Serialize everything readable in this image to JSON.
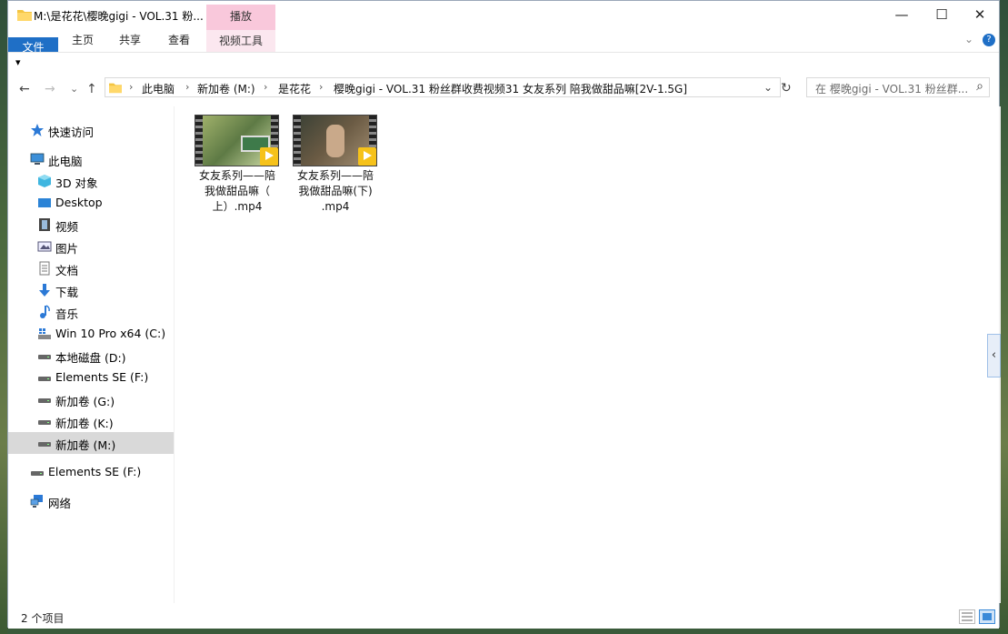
{
  "window": {
    "title": "M:\\是花花\\樱晚gigi - VOL.31 粉...",
    "context_tab": "播放",
    "context_subtab": "视频工具",
    "controls": [
      "—",
      "☐",
      "✕"
    ]
  },
  "ribbon": {
    "tabs": [
      "文件",
      "主页",
      "共享",
      "查看"
    ],
    "expand_glyph": "⌄",
    "help_glyph": "?"
  },
  "qa": {
    "glyph": "▾"
  },
  "nav": {
    "back": "←",
    "forward": "→",
    "recent": "⌄",
    "up": "↑",
    "breadcrumbs": [
      "此电脑",
      "新加卷 (M:)",
      "是花花",
      "樱晚gigi - VOL.31 粉丝群收费视频31 女友系列 陪我做甜品嘛[2V-1.5G]"
    ],
    "sep": "›",
    "dropdown": "⌄",
    "refresh": "↻",
    "search_placeholder": "在 樱晚gigi - VOL.31 粉丝群...",
    "search_icon": "⌕"
  },
  "sidebar": {
    "items": [
      {
        "label": "快速访问",
        "icon": "star-icon",
        "color": "#2b79d6"
      },
      {
        "label": "此电脑",
        "icon": "computer-icon",
        "color": "#3c8fd8"
      },
      {
        "label": "3D 对象",
        "icon": "cube-icon",
        "color": "#3fb6e0"
      },
      {
        "label": "Desktop",
        "icon": "desktop-icon",
        "color": "#2b83d6"
      },
      {
        "label": "视频",
        "icon": "film-icon",
        "color": "#555"
      },
      {
        "label": "图片",
        "icon": "picture-icon",
        "color": "#557"
      },
      {
        "label": "文档",
        "icon": "document-icon",
        "color": "#777"
      },
      {
        "label": "下载",
        "icon": "download-icon",
        "color": "#2b79d6"
      },
      {
        "label": "音乐",
        "icon": "music-icon",
        "color": "#2b79d6"
      },
      {
        "label": "Win 10 Pro x64 (C:)",
        "icon": "windows-drive-icon",
        "color": "#2b79d6"
      },
      {
        "label": "本地磁盘 (D:)",
        "icon": "drive-icon",
        "color": "#555"
      },
      {
        "label": "Elements SE (F:)",
        "icon": "drive-icon",
        "color": "#555"
      },
      {
        "label": "新加卷 (G:)",
        "icon": "drive-icon",
        "color": "#555"
      },
      {
        "label": "新加卷 (K:)",
        "icon": "drive-icon",
        "color": "#555"
      },
      {
        "label": "新加卷 (M:)",
        "icon": "drive-icon",
        "color": "#555"
      },
      {
        "label": "Elements SE (F:)",
        "icon": "drive-icon",
        "color": "#555"
      },
      {
        "label": "网络",
        "icon": "network-icon",
        "color": "#2b79d6"
      }
    ],
    "selected_index": 14
  },
  "files": [
    {
      "name": "女友系列——陪我做甜品嘛（上）.mp4",
      "line1": "女友系列——陪",
      "line2": "我做甜品嘛（",
      "line3": "上）.mp4",
      "thumb_color": "#6f8a4f"
    },
    {
      "name": "女友系列——陪我做甜品嘛(下).mp4",
      "line1": "女友系列——陪",
      "line2": "我做甜品嘛(下)",
      "line3": ".mp4",
      "thumb_color": "#5a5448"
    }
  ],
  "status": {
    "text": "2 个项目"
  },
  "side_panel": {
    "collapse_glyph": "‹"
  }
}
